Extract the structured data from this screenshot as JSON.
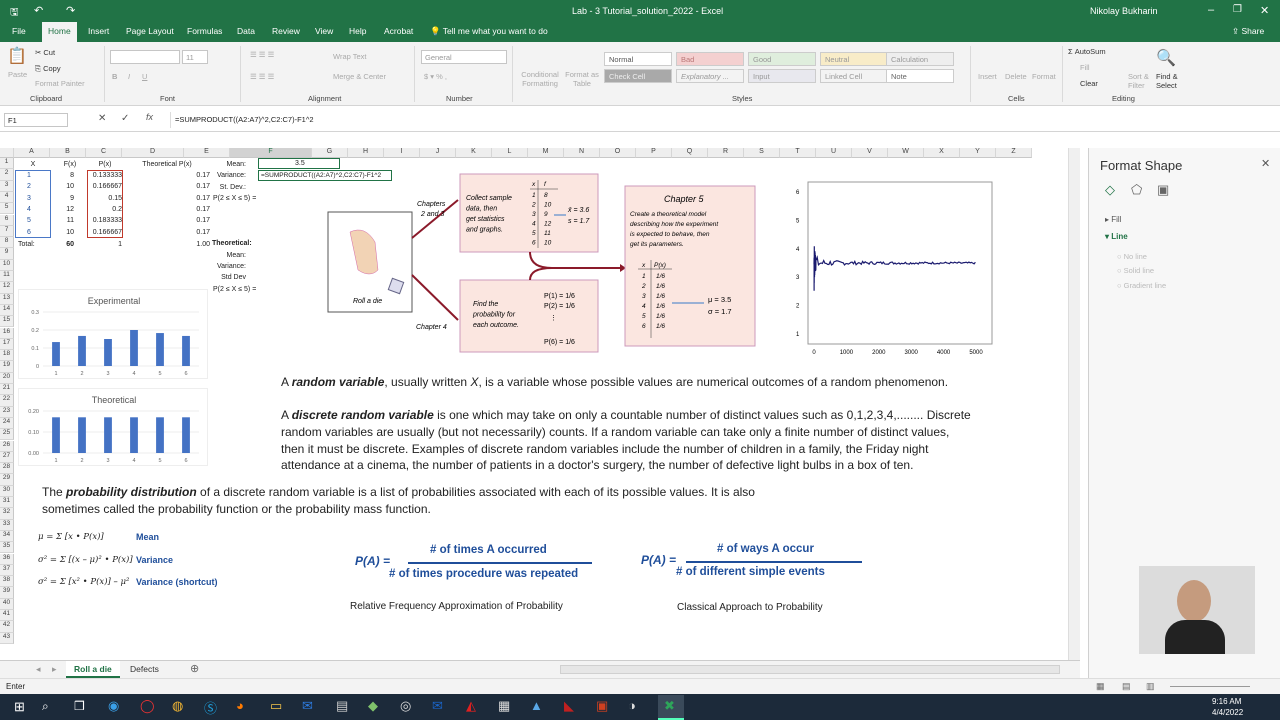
{
  "window": {
    "title": "Lab - 3 Tutorial_solution_2022 - Excel",
    "user": "Nikolay Bukharin",
    "share": "Share"
  },
  "colors": {
    "accent": "#217346",
    "blue": "#1f4e9a"
  },
  "tabs": [
    "File",
    "Home",
    "Insert",
    "Page Layout",
    "Formulas",
    "Data",
    "Review",
    "View",
    "Help",
    "Acrobat",
    "Tell me what you want to do"
  ],
  "ribbon": {
    "clipboard": {
      "paste": "Paste",
      "cut": "Cut",
      "copy": "Copy",
      "format_painter": "Format Painter",
      "label": "Clipboard"
    },
    "font": {
      "size": "11",
      "label": "Font"
    },
    "alignment": {
      "wrap": "Wrap Text",
      "merge": "Merge & Center",
      "label": "Alignment"
    },
    "number": {
      "format": "General",
      "label": "Number"
    },
    "styles": {
      "conditional": "Conditional Formatting",
      "format_table": "Format as Table",
      "label": "Styles",
      "cells": [
        "Normal",
        "Bad",
        "Good",
        "Neutral",
        "Calculation",
        "Check Cell",
        "Explanatory ...",
        "Input",
        "Linked Cell",
        "Note"
      ]
    },
    "cells": {
      "insert": "Insert",
      "delete": "Delete",
      "format": "Format",
      "label": "Cells"
    },
    "editing": {
      "autosum": "AutoSum",
      "fill": "Fill",
      "clear": "Clear",
      "sort": "Sort & Filter",
      "find": "Find & Select",
      "label": "Editing"
    }
  },
  "formula_bar": {
    "name_box": "F1",
    "formula": "=SUMPRODUCT((A2:A7)^2,C2:C7)-F1^2"
  },
  "columns": [
    "A",
    "B",
    "C",
    "D",
    "E",
    "F",
    "G",
    "H",
    "I",
    "J",
    "K",
    "L",
    "M",
    "N",
    "O",
    "P",
    "Q",
    "R",
    "S",
    "T",
    "U",
    "V",
    "W",
    "X",
    "Y",
    "Z"
  ],
  "rows": [
    "1",
    "2",
    "3",
    "4",
    "5",
    "6",
    "7",
    "8",
    "9",
    "10",
    "11",
    "12",
    "13",
    "14",
    "15",
    "16",
    "17",
    "18",
    "19",
    "20",
    "21",
    "22",
    "23",
    "24",
    "25",
    "26",
    "27",
    "28",
    "29",
    "30",
    "31",
    "32",
    "33",
    "34",
    "35",
    "36",
    "37",
    "38",
    "39",
    "40",
    "41",
    "42",
    "43"
  ],
  "table": {
    "headers": [
      "X",
      "F(x)",
      "P(x)",
      "Theoretical P(x)"
    ],
    "rows": [
      [
        "1",
        "8",
        "0.133333",
        "0.17"
      ],
      [
        "2",
        "10",
        "0.166667",
        "0.17"
      ],
      [
        "3",
        "9",
        "0.15",
        "0.17"
      ],
      [
        "4",
        "12",
        "0.2",
        "0.17"
      ],
      [
        "5",
        "11",
        "0.183333",
        "0.17"
      ],
      [
        "6",
        "10",
        "0.166667",
        "0.17"
      ]
    ],
    "total_label": "Total:",
    "total_f": "60",
    "total_p": "1",
    "total_theo": "1.00"
  },
  "stats": {
    "mean": "Mean:",
    "variance": "Variance:",
    "stdev": "St. Dev.:",
    "prob": "P(2 ≤ X ≤ 5) =",
    "theoretical": "Theoretical:",
    "t_mean": "Mean:",
    "t_variance": "Variance:",
    "t_stdev": "Std Dev",
    "t_prob": "P(2 ≤ X ≤ 5) =",
    "f1_value": "3.5",
    "edit_formula": "=SUMPRODUCT((A2:A7)^2,C2:C7)-F1^2"
  },
  "charts": [
    {
      "type": "bar",
      "title": "Experimental",
      "categories": [
        "1",
        "2",
        "3",
        "4",
        "5",
        "6"
      ],
      "values": [
        0.133,
        0.167,
        0.15,
        0.2,
        0.183,
        0.167
      ],
      "ticks": [
        "0.3",
        "0.2",
        "0.1",
        "0"
      ],
      "ylim": [
        0,
        0.3
      ]
    },
    {
      "type": "bar",
      "title": "Theoretical",
      "categories": [
        "1",
        "2",
        "3",
        "4",
        "5",
        "6"
      ],
      "values": [
        0.17,
        0.17,
        0.17,
        0.17,
        0.17,
        0.17
      ],
      "ticks": [
        "0.20",
        "0.10",
        "0.00"
      ],
      "ylim": [
        0,
        0.2
      ]
    }
  ],
  "line_chart": {
    "ticks_y": [
      "6",
      "5",
      "4",
      "3",
      "2",
      "1"
    ],
    "ticks_x": [
      "0",
      "1000",
      "2000",
      "3000",
      "4000",
      "5000"
    ],
    "ylim": [
      1,
      6
    ],
    "xlim": [
      0,
      5000
    ],
    "converge": 3.5
  },
  "diagram": {
    "roll": "Roll a die",
    "ch23": [
      "Chapters",
      "2 and 3"
    ],
    "ch4": "Chapter 4",
    "collect": [
      "Collect sample",
      "data, then",
      "get statistics",
      "and graphs."
    ],
    "xs": [
      "1",
      "2",
      "3",
      "4",
      "5",
      "6"
    ],
    "fs": [
      "8",
      "10",
      "9",
      "12",
      "11",
      "10"
    ],
    "xbar": "x̄ = 3.6",
    "s": "s = 1.7",
    "find": [
      "Find the",
      "probability for",
      "each outcome."
    ],
    "p1": "P(1) = 1/6",
    "p2": "P(2) = 1/6",
    "p6": "P(6) = 1/6",
    "ch5_title": "Chapter 5",
    "ch5_text": [
      "Create a theoretical model",
      "describing how the experiment",
      "is expected to behave, then",
      "get its parameters."
    ],
    "px": "1/6",
    "mu": "μ = 3.5",
    "sigma": "σ = 1.7",
    "xhead": "x",
    "fhead": "f",
    "pxhead": "P(x)"
  },
  "text": {
    "rv_1": "A ",
    "rv_b": "random variable",
    "rv_2": ", usually written ",
    "rv_x": "X",
    "rv_3": ", is a variable whose possible values are numerical outcomes of a random phenomenon.",
    "drv_1": "A ",
    "drv_b": "discrete random variable",
    "drv_2": " is one which may take on only a countable number of distinct values such as 0,1,2,3,4,........ Discrete",
    "drv_l2": "random variables are usually (but not necessarily) counts. If a random variable can take only a finite number of distinct values,",
    "drv_l3": "then it must be discrete. Examples of discrete random variables include the number of children in a family, the Friday night",
    "drv_l4": "attendance at a cinema, the number of patients in a doctor's surgery, the number of defective light bulbs in a box of ten.",
    "pd_1": "The ",
    "pd_b": "probability distribution",
    "pd_2": " of a discrete random variable is a list of probabilities associated with each of its possible values. It is also",
    "pd_l2": "sometimes called the probability function or the probability mass function."
  },
  "formulas": {
    "mean_f": "μ = Σ [x • P(x)]",
    "mean_l": "Mean",
    "var_f": "σ² = Σ [(x – μ)² • P(x)]",
    "var_l": "Variance",
    "vars_f": "σ² = Σ [x² • P(x)] – μ²",
    "vars_l": "Variance (shortcut)",
    "pa": "P(A) =",
    "rf_num": "# of times A occurred",
    "rf_den": "# of times procedure was repeated",
    "rf_cap": "Relative Frequency Approximation of Probability",
    "cl_num": "# of ways A occur",
    "cl_den": "# of different simple events",
    "cl_cap": "Classical Approach to Probability"
  },
  "sheets": [
    "Roll a die",
    "Defects"
  ],
  "status": "Enter",
  "pane": {
    "title": "Format Shape",
    "fill": "Fill",
    "line": "Line",
    "opts": [
      "No line",
      "Solid line",
      "Gradient line"
    ]
  },
  "clock": {
    "time": "9:16 AM",
    "date": "4/4/2022"
  }
}
